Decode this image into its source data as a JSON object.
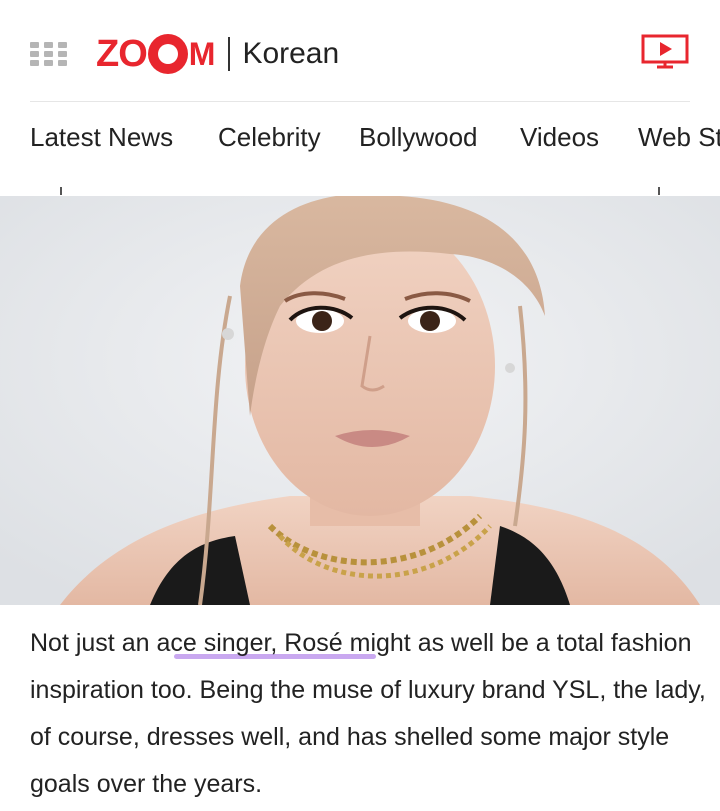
{
  "header": {
    "logo_text": "ZOOM",
    "section": "Korean",
    "colors": {
      "brand": "#e8262e",
      "menu_icon": "#b5b5b5"
    }
  },
  "nav": {
    "items": [
      "Latest News",
      "Celebrity",
      "Bollywood",
      "Videos",
      "Web St"
    ]
  },
  "hero": {
    "alt": "Portrait of Rosé"
  },
  "article": {
    "before": "Not just an ",
    "highlight": "ace singer, Rosé",
    "after": " might as well be a total fashion inspiration too. Being the muse of luxury brand YSL, the lady, of course, dresses well, and has shelled some major style goals over the years.",
    "highlight_color": "#c9a8f0"
  }
}
